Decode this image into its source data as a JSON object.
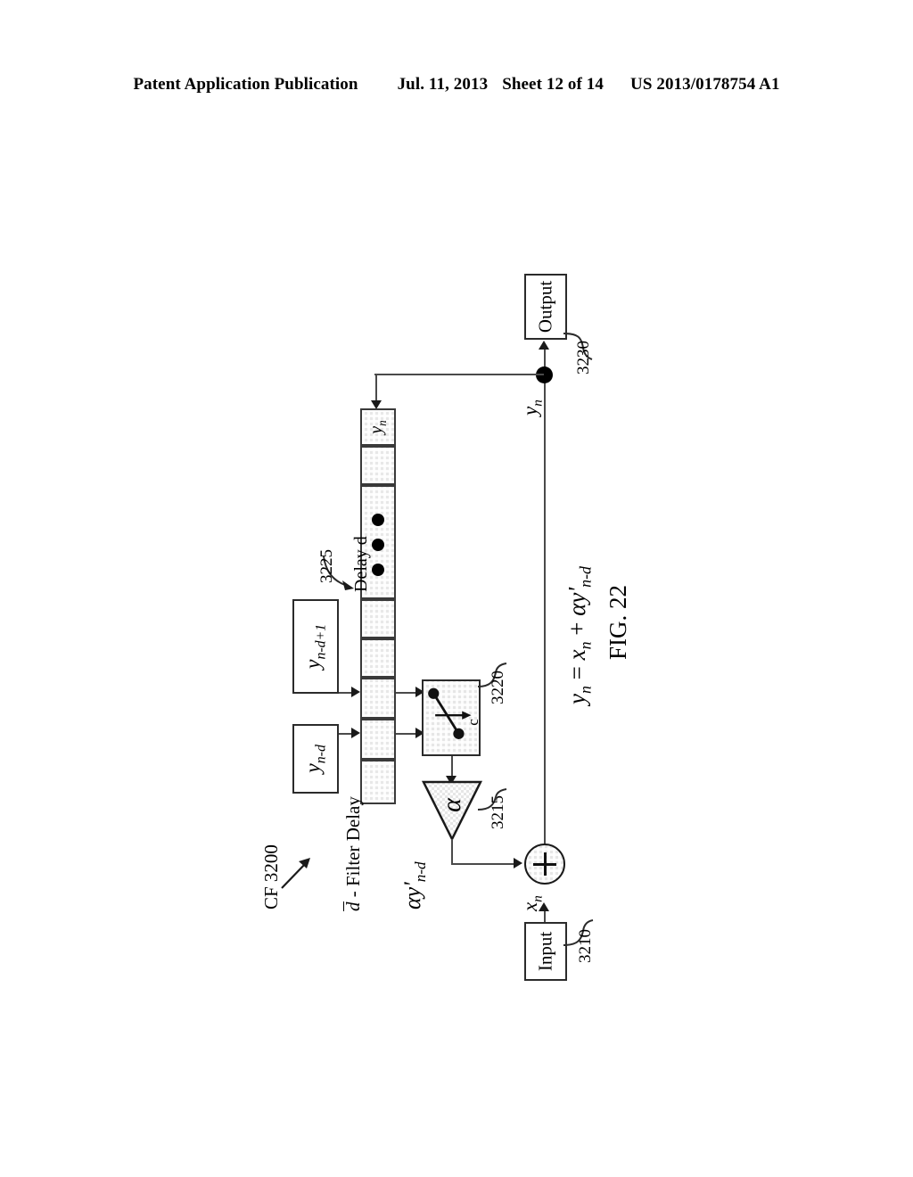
{
  "header": {
    "publication": "Patent Application Publication",
    "date": "Jul. 11, 2013",
    "sheet": "Sheet 12 of 14",
    "patent_number": "US 2013/0178754 A1"
  },
  "figure": {
    "caption": "FIG. 22",
    "system_label": "CF 3200",
    "legend": "- Filter Delay",
    "legend_symbol": "d",
    "blocks": {
      "input": {
        "label": "Input",
        "ref": "3210"
      },
      "output": {
        "label": "Output",
        "ref": "3230"
      },
      "amplifier": {
        "label": "α",
        "ref": "3215"
      },
      "switch": {
        "label": "c",
        "ref": "3220"
      },
      "delay_line": {
        "label": "Delay d",
        "ref": "3225",
        "first_cell": "y",
        "first_cell_sub": "n",
        "cell_count": 11,
        "ellipsis_dots": 3
      }
    },
    "tap_labels": [
      {
        "base": "y",
        "sub": "n-d+1"
      },
      {
        "base": "y",
        "sub": "n-d"
      }
    ],
    "signals": {
      "input_signal": {
        "base": "x",
        "sub": "n"
      },
      "output_signal": {
        "base": "y",
        "sub": "n"
      },
      "feedback_signal": {
        "base": "αy'",
        "sub": "n-d"
      }
    },
    "equation": {
      "lhs": "y",
      "lhs_sub": "n",
      "text": "y n = x n + αy' n-d",
      "parts": [
        "y",
        "n",
        "=",
        "x",
        "n",
        "+",
        "αy'",
        "n-d"
      ]
    }
  }
}
